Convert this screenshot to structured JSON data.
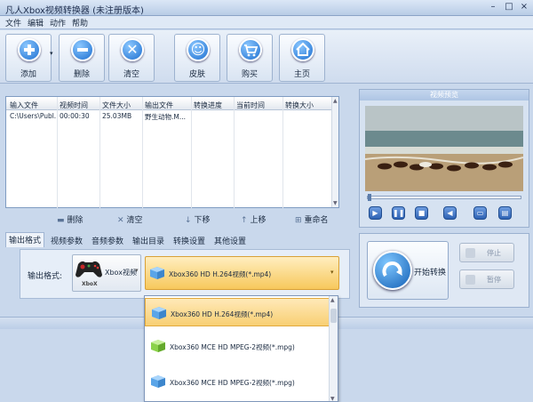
{
  "window": {
    "title": "凡人Xbox视频转换器   (未注册版本)"
  },
  "menu": [
    "文件",
    "编辑",
    "动作",
    "帮助"
  ],
  "toolbar": [
    {
      "label": "添加",
      "icon": "plus-icon",
      "color": "#2b7fe0"
    },
    {
      "label": "删除",
      "icon": "minus-icon",
      "color": "#2b7fe0"
    },
    {
      "label": "清空",
      "icon": "clear-x-icon",
      "color": "#2b7fe0"
    },
    {
      "label": "皮肤",
      "icon": "smiley-icon",
      "color": "#2b7fe0"
    },
    {
      "label": "购买",
      "icon": "cart-icon",
      "color": "#2b7fe0"
    },
    {
      "label": "主页",
      "icon": "home-icon",
      "color": "#2b7fe0"
    }
  ],
  "file_table": {
    "headers": [
      "输入文件",
      "视频时间",
      "文件大小",
      "输出文件",
      "转换进度",
      "当前时间",
      "转换大小"
    ],
    "rows": [
      [
        "C:\\Users\\Publ...",
        "00:00:30",
        "25.03MB",
        "野生动物.M...",
        "",
        "",
        ""
      ]
    ]
  },
  "list_actions": [
    "删除",
    "清空",
    "下移",
    "上移",
    "重命名"
  ],
  "tabs": [
    "输出格式",
    "视频参数",
    "音频参数",
    "输出目录",
    "转换设置",
    "其他设置"
  ],
  "output_format": {
    "label": "输出格式:",
    "device": "Xbox视频",
    "device_badge": "XboX",
    "selected_format": "Xbox360 HD H.264视频(*.mp4)"
  },
  "dropdown_options": [
    {
      "label": "Xbox360 HD H.264视频(*.mp4)",
      "selected": true,
      "cube_color": "#5aa5e8"
    },
    {
      "label": "Xbox360 MCE HD MPEG-2视频(*.mpg)",
      "selected": false,
      "cube_color": "#8bd24a"
    },
    {
      "label": "Xbox360 MCE HD MPEG-2视频(*.mpg)",
      "selected": false,
      "cube_color": "#5aa5e8"
    }
  ],
  "preview": {
    "title": "视频预览"
  },
  "controls": {
    "start": "开始转换",
    "stop": "停止",
    "pause": "暂停"
  }
}
